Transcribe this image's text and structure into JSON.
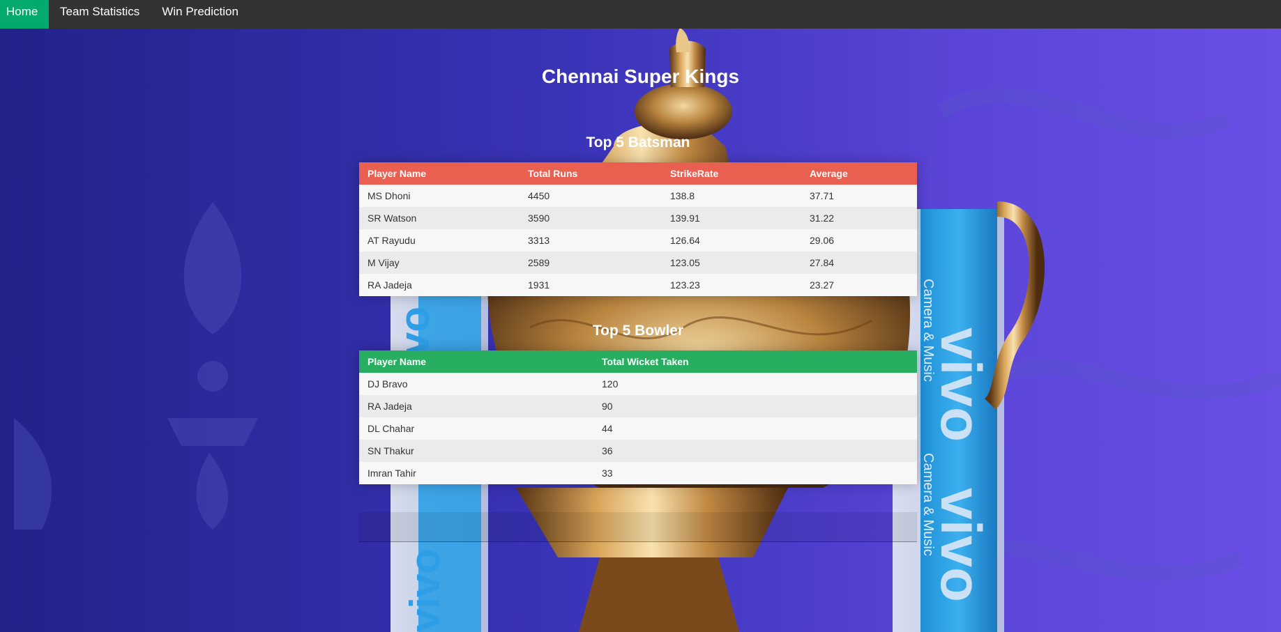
{
  "nav": {
    "items": [
      {
        "label": "Home",
        "active": true
      },
      {
        "label": "Team Statistics",
        "active": false
      },
      {
        "label": "Win Prediction",
        "active": false
      }
    ]
  },
  "team": {
    "name": "Chennai Super Kings"
  },
  "batsman": {
    "title": "Top 5 Batsman",
    "headers": [
      "Player Name",
      "Total Runs",
      "StrikeRate",
      "Average"
    ],
    "rows": [
      [
        "MS Dhoni",
        "4450",
        "138.8",
        "37.71"
      ],
      [
        "SR Watson",
        "3590",
        "139.91",
        "31.22"
      ],
      [
        "AT Rayudu",
        "3313",
        "126.64",
        "29.06"
      ],
      [
        "M Vijay",
        "2589",
        "123.05",
        "27.84"
      ],
      [
        "RA Jadeja",
        "1931",
        "123.23",
        "23.27"
      ]
    ]
  },
  "bowler": {
    "title": "Top 5 Bowler",
    "headers": [
      "Player Name",
      "Total Wicket Taken"
    ],
    "rows": [
      [
        "DJ Bravo",
        "120"
      ],
      [
        "RA Jadeja",
        "90"
      ],
      [
        "DL Chahar",
        "44"
      ],
      [
        "SN Thakur",
        "36"
      ],
      [
        "Imran Tahir",
        "33"
      ]
    ]
  },
  "background": {
    "ribbon_text": "vivo",
    "ribbon_subtext": "Camera & Music"
  },
  "colors": {
    "nav_bg": "#333333",
    "nav_active": "#04aa6d",
    "batsman_header": "#e95f50",
    "bowler_header": "#27ae60",
    "row_odd": "#f7f7f7",
    "row_even": "#ebebeb"
  }
}
